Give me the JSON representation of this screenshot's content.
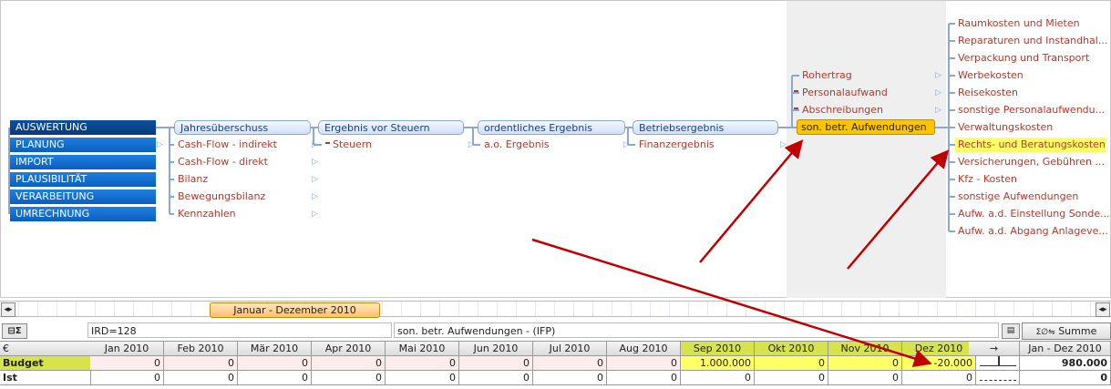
{
  "sidebar": {
    "items": [
      "AUSWERTUNG",
      "PLANUNG",
      "IMPORT",
      "PLAUSIBILITÄT",
      "VERARBEITUNG",
      "UMRECHNUNG"
    ]
  },
  "level1": {
    "items": [
      "Jahresüberschuss",
      "Cash-Flow - indirekt",
      "Cash-Flow - direkt",
      "Bilanz",
      "Bewegungsbilanz",
      "Kennzahlen"
    ]
  },
  "level2": {
    "items": [
      "Ergebnis vor Steuern",
      "Steuern"
    ]
  },
  "level3": {
    "items": [
      "ordentliches Ergebnis",
      "a.o. Ergebnis"
    ]
  },
  "level4": {
    "items": [
      "Betriebsergebnis",
      "Finanzergebnis"
    ]
  },
  "level5": {
    "items": [
      "Rohertrag",
      "Personalaufwand",
      "Abschreibungen",
      "son. betr. Aufwendungen"
    ]
  },
  "level6": {
    "items": [
      "Raumkosten und Mieten",
      "Reparaturen und Instandhal...",
      "Verpackung und Transport",
      "Werbekosten",
      "Reisekosten",
      "sonstige Personalaufwendu...",
      "Verwaltungskosten",
      "Rechts- und Beratungskosten",
      "Versicherungen, Gebühren ...",
      "Kfz - Kosten",
      "sonstige Aufwendungen",
      "Aufw. a.d. Einstellung Sonde...",
      "Aufw. a.d. Abgang Anlageve..."
    ]
  },
  "timeline": {
    "label": "Januar - Dezember 2010"
  },
  "info": {
    "ird": "IRD=128",
    "account": "son. betr. Aufwendungen - (IFP)",
    "sum_button": "Summe",
    "sum_icon_text": "Σ∅⇋"
  },
  "grid": {
    "currency": "€",
    "months": [
      "Jan 2010",
      "Feb 2010",
      "Mär 2010",
      "Apr 2010",
      "Mai 2010",
      "Jun 2010",
      "Jul 2010",
      "Aug 2010",
      "Sep 2010",
      "Okt 2010",
      "Nov 2010",
      "Dez 2010"
    ],
    "arrow": "→",
    "total_header": "Jan - Dez 2010",
    "rows": [
      {
        "label": "Budget",
        "values": [
          "0",
          "0",
          "0",
          "0",
          "0",
          "0",
          "0",
          "0",
          "1.000.000",
          "0",
          "0",
          "-20.000"
        ],
        "total": "980.000"
      },
      {
        "label": "Ist",
        "values": [
          "0",
          "0",
          "0",
          "0",
          "0",
          "0",
          "0",
          "0",
          "0",
          "0",
          "0",
          "0"
        ],
        "total": "0"
      }
    ]
  },
  "colors": {
    "accent_blue": "#0a5fc0",
    "selected": "#ffc400",
    "highlight": "#ffff66",
    "arrow_red": "#c00000",
    "leaf_text": "#b03a2e"
  }
}
